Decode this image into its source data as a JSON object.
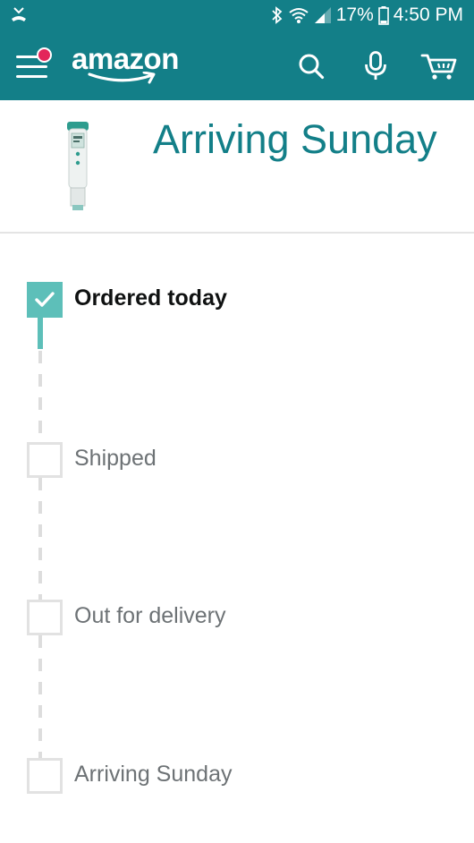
{
  "status_bar": {
    "battery_percent": "17%",
    "time": "4:50 PM",
    "icons": [
      "missed-call-icon",
      "bluetooth-icon",
      "wifi-icon",
      "signal-icon",
      "battery-icon"
    ]
  },
  "app_bar": {
    "logo_text": "amazon",
    "icons": [
      "menu-icon",
      "search-icon",
      "microphone-icon",
      "cart-icon"
    ],
    "notification_dot_color": "#e3265a",
    "background_color": "#137f88"
  },
  "shipment": {
    "headline": "Arriving Sunday",
    "headline_color": "#137f88"
  },
  "timeline": {
    "accent_color": "#5dbfb9",
    "steps": [
      {
        "label": "Ordered today",
        "completed": true
      },
      {
        "label": "Shipped",
        "completed": false
      },
      {
        "label": "Out for delivery",
        "completed": false
      },
      {
        "label": "Arriving Sunday",
        "completed": false
      }
    ]
  }
}
